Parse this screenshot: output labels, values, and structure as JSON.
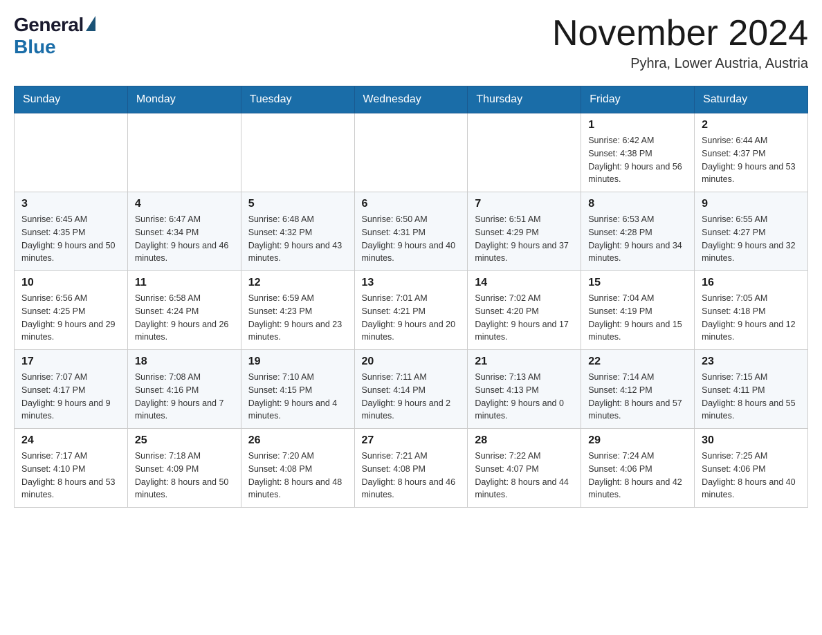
{
  "header": {
    "logo_general": "General",
    "logo_blue": "Blue",
    "month_title": "November 2024",
    "location": "Pyhra, Lower Austria, Austria"
  },
  "days_of_week": [
    "Sunday",
    "Monday",
    "Tuesday",
    "Wednesday",
    "Thursday",
    "Friday",
    "Saturday"
  ],
  "weeks": [
    {
      "days": [
        {
          "date": "",
          "info": ""
        },
        {
          "date": "",
          "info": ""
        },
        {
          "date": "",
          "info": ""
        },
        {
          "date": "",
          "info": ""
        },
        {
          "date": "",
          "info": ""
        },
        {
          "date": "1",
          "info": "Sunrise: 6:42 AM\nSunset: 4:38 PM\nDaylight: 9 hours and 56 minutes."
        },
        {
          "date": "2",
          "info": "Sunrise: 6:44 AM\nSunset: 4:37 PM\nDaylight: 9 hours and 53 minutes."
        }
      ]
    },
    {
      "days": [
        {
          "date": "3",
          "info": "Sunrise: 6:45 AM\nSunset: 4:35 PM\nDaylight: 9 hours and 50 minutes."
        },
        {
          "date": "4",
          "info": "Sunrise: 6:47 AM\nSunset: 4:34 PM\nDaylight: 9 hours and 46 minutes."
        },
        {
          "date": "5",
          "info": "Sunrise: 6:48 AM\nSunset: 4:32 PM\nDaylight: 9 hours and 43 minutes."
        },
        {
          "date": "6",
          "info": "Sunrise: 6:50 AM\nSunset: 4:31 PM\nDaylight: 9 hours and 40 minutes."
        },
        {
          "date": "7",
          "info": "Sunrise: 6:51 AM\nSunset: 4:29 PM\nDaylight: 9 hours and 37 minutes."
        },
        {
          "date": "8",
          "info": "Sunrise: 6:53 AM\nSunset: 4:28 PM\nDaylight: 9 hours and 34 minutes."
        },
        {
          "date": "9",
          "info": "Sunrise: 6:55 AM\nSunset: 4:27 PM\nDaylight: 9 hours and 32 minutes."
        }
      ]
    },
    {
      "days": [
        {
          "date": "10",
          "info": "Sunrise: 6:56 AM\nSunset: 4:25 PM\nDaylight: 9 hours and 29 minutes."
        },
        {
          "date": "11",
          "info": "Sunrise: 6:58 AM\nSunset: 4:24 PM\nDaylight: 9 hours and 26 minutes."
        },
        {
          "date": "12",
          "info": "Sunrise: 6:59 AM\nSunset: 4:23 PM\nDaylight: 9 hours and 23 minutes."
        },
        {
          "date": "13",
          "info": "Sunrise: 7:01 AM\nSunset: 4:21 PM\nDaylight: 9 hours and 20 minutes."
        },
        {
          "date": "14",
          "info": "Sunrise: 7:02 AM\nSunset: 4:20 PM\nDaylight: 9 hours and 17 minutes."
        },
        {
          "date": "15",
          "info": "Sunrise: 7:04 AM\nSunset: 4:19 PM\nDaylight: 9 hours and 15 minutes."
        },
        {
          "date": "16",
          "info": "Sunrise: 7:05 AM\nSunset: 4:18 PM\nDaylight: 9 hours and 12 minutes."
        }
      ]
    },
    {
      "days": [
        {
          "date": "17",
          "info": "Sunrise: 7:07 AM\nSunset: 4:17 PM\nDaylight: 9 hours and 9 minutes."
        },
        {
          "date": "18",
          "info": "Sunrise: 7:08 AM\nSunset: 4:16 PM\nDaylight: 9 hours and 7 minutes."
        },
        {
          "date": "19",
          "info": "Sunrise: 7:10 AM\nSunset: 4:15 PM\nDaylight: 9 hours and 4 minutes."
        },
        {
          "date": "20",
          "info": "Sunrise: 7:11 AM\nSunset: 4:14 PM\nDaylight: 9 hours and 2 minutes."
        },
        {
          "date": "21",
          "info": "Sunrise: 7:13 AM\nSunset: 4:13 PM\nDaylight: 9 hours and 0 minutes."
        },
        {
          "date": "22",
          "info": "Sunrise: 7:14 AM\nSunset: 4:12 PM\nDaylight: 8 hours and 57 minutes."
        },
        {
          "date": "23",
          "info": "Sunrise: 7:15 AM\nSunset: 4:11 PM\nDaylight: 8 hours and 55 minutes."
        }
      ]
    },
    {
      "days": [
        {
          "date": "24",
          "info": "Sunrise: 7:17 AM\nSunset: 4:10 PM\nDaylight: 8 hours and 53 minutes."
        },
        {
          "date": "25",
          "info": "Sunrise: 7:18 AM\nSunset: 4:09 PM\nDaylight: 8 hours and 50 minutes."
        },
        {
          "date": "26",
          "info": "Sunrise: 7:20 AM\nSunset: 4:08 PM\nDaylight: 8 hours and 48 minutes."
        },
        {
          "date": "27",
          "info": "Sunrise: 7:21 AM\nSunset: 4:08 PM\nDaylight: 8 hours and 46 minutes."
        },
        {
          "date": "28",
          "info": "Sunrise: 7:22 AM\nSunset: 4:07 PM\nDaylight: 8 hours and 44 minutes."
        },
        {
          "date": "29",
          "info": "Sunrise: 7:24 AM\nSunset: 4:06 PM\nDaylight: 8 hours and 42 minutes."
        },
        {
          "date": "30",
          "info": "Sunrise: 7:25 AM\nSunset: 4:06 PM\nDaylight: 8 hours and 40 minutes."
        }
      ]
    }
  ]
}
